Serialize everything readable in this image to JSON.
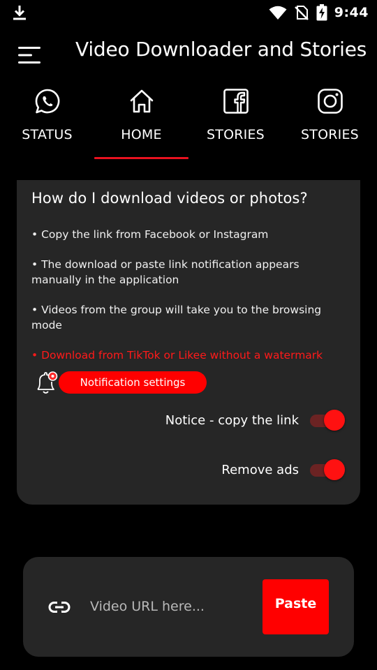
{
  "status_bar": {
    "time": "9:44",
    "icons": [
      "download-icon",
      "wifi-icon",
      "no-sim-icon",
      "battery-charging-icon"
    ]
  },
  "app_bar": {
    "title": "Video Downloader and Stories",
    "menu_icon": "menu-icon"
  },
  "tabs": [
    {
      "label": "STATUS",
      "icon": "whatsapp-icon",
      "selected": false
    },
    {
      "label": "HOME",
      "icon": "home-icon",
      "selected": true
    },
    {
      "label": "STORIES",
      "icon": "facebook-icon",
      "selected": false
    },
    {
      "label": "STORIES",
      "icon": "instagram-icon",
      "selected": false
    }
  ],
  "info_card": {
    "title": "How do I download videos or photos?",
    "bullets": [
      "• Copy the link from Facebook or Instagram",
      "• The download or paste link notification appears manually in the application",
      "• Videos from the group will take you to the browsing mode",
      "• Download from TikTok or Likee without a watermark"
    ],
    "notification_button": "Notification settings",
    "toggles": [
      {
        "label": "Notice - copy the link",
        "on": true
      },
      {
        "label": "Remove ads",
        "on": true
      }
    ]
  },
  "url_bar": {
    "placeholder": "Video URL here...",
    "value": "",
    "paste_label": "Paste"
  },
  "colors": {
    "accent": "#ff0000",
    "background": "#000000",
    "card": "#262626",
    "toggle_track": "#6b2323"
  }
}
